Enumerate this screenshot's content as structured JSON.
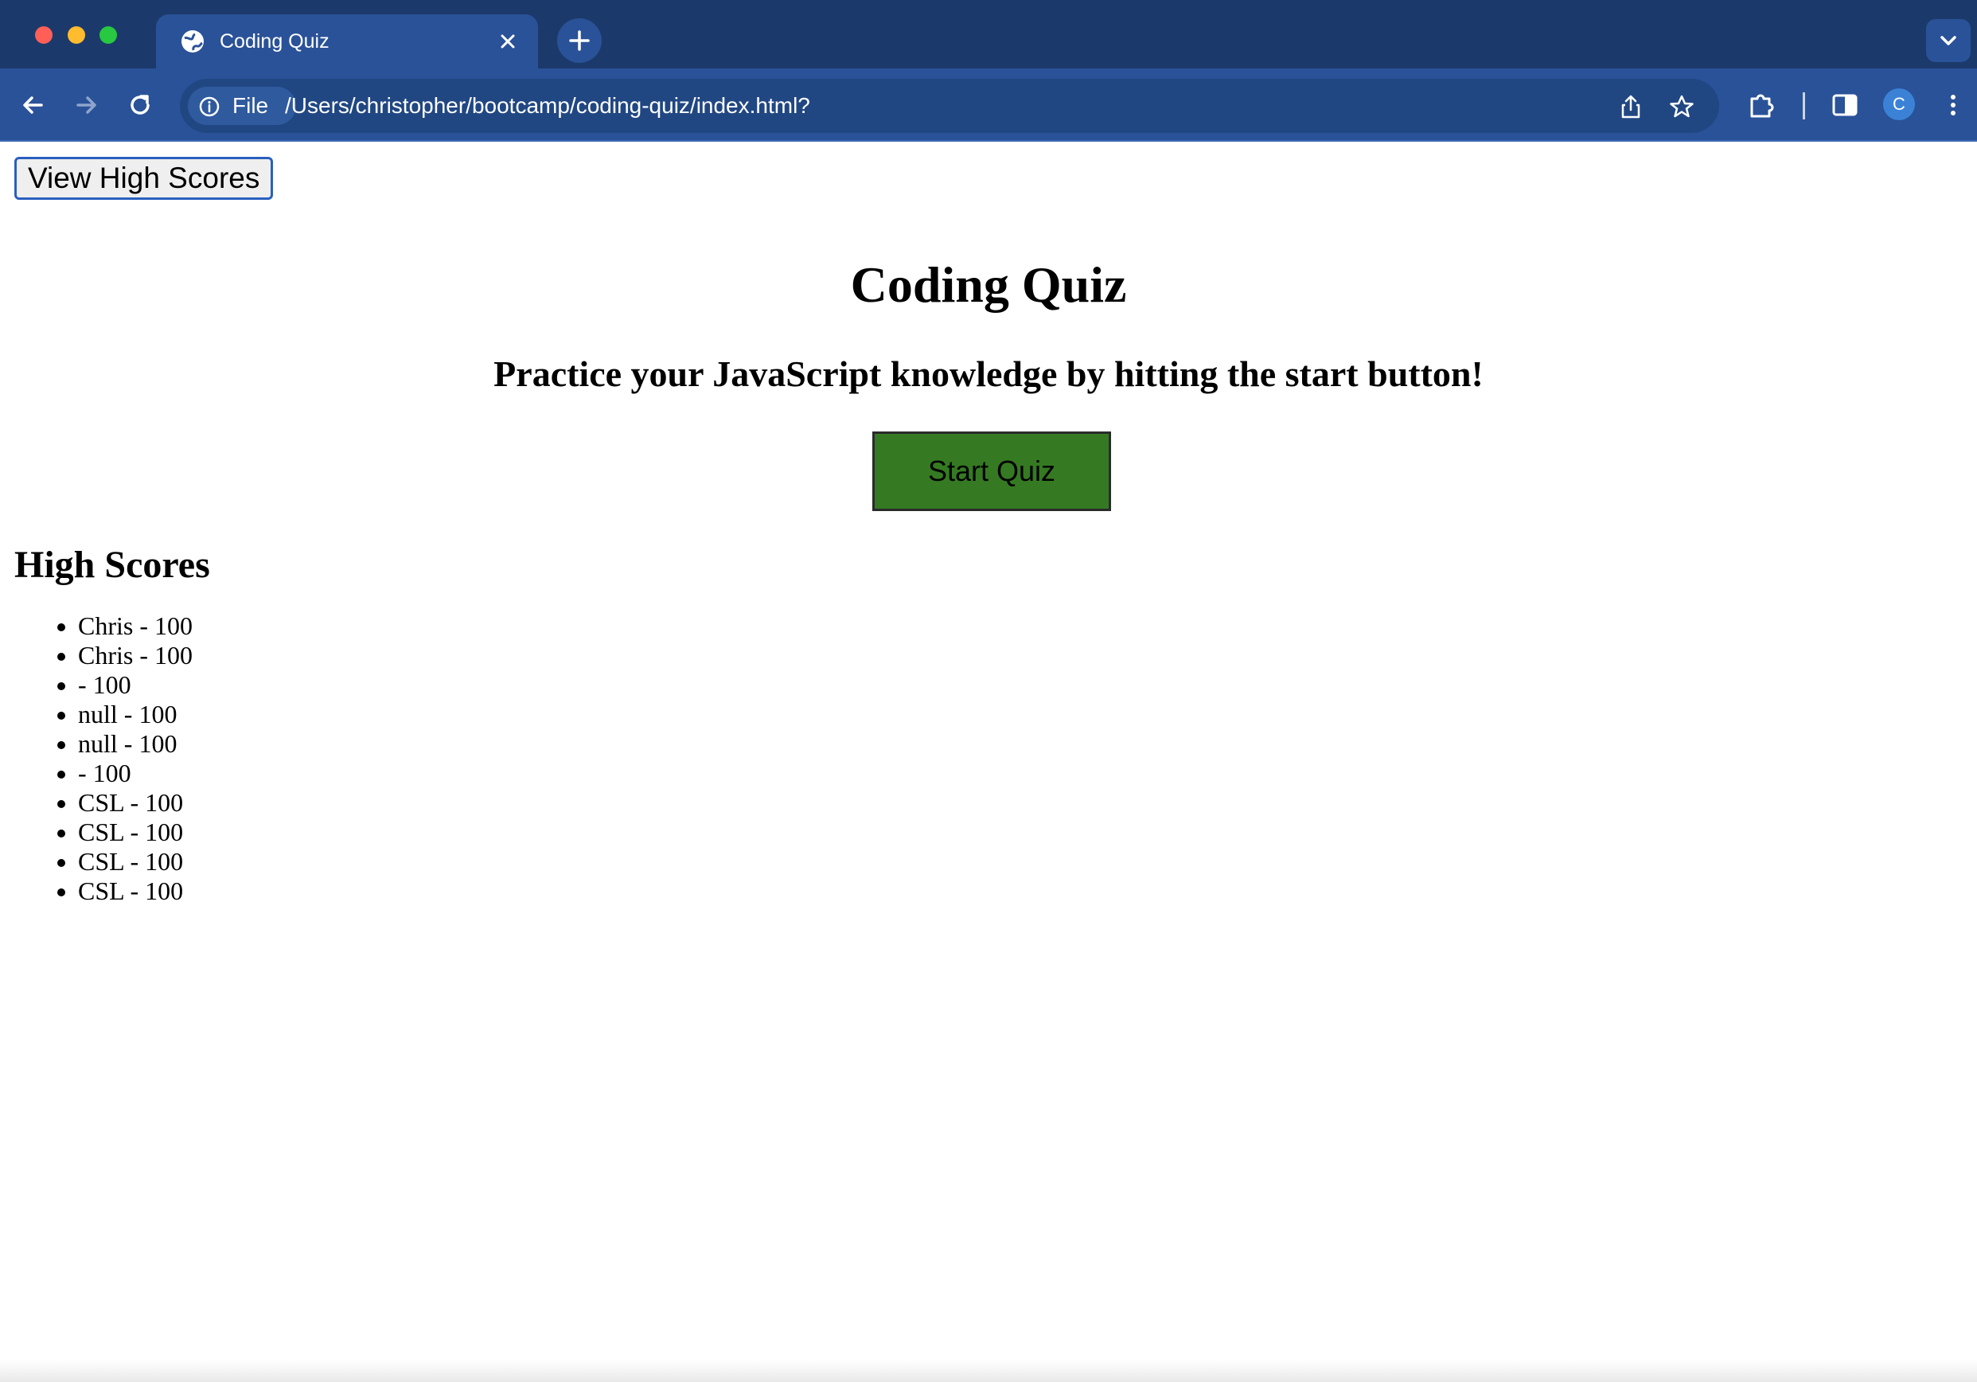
{
  "browser": {
    "tab_title": "Coding Quiz",
    "address_chip": "File",
    "url": "/Users/christopher/bootcamp/coding-quiz/index.html?",
    "profile_initial": "C"
  },
  "page": {
    "high_scores_button": "View High Scores",
    "title": "Coding Quiz",
    "subtitle": "Practice your JavaScript knowledge by hitting the start button!",
    "start_button": "Start Quiz",
    "high_scores_heading": "High Scores",
    "high_scores": [
      "Chris - 100",
      "Chris - 100",
      "- 100",
      "null - 100",
      "null - 100",
      "- 100",
      "CSL - 100",
      "CSL - 100",
      "CSL - 100",
      "CSL - 100"
    ]
  },
  "colors": {
    "tabbar": "#1b3a6b",
    "toolbar": "#2a5298",
    "start_button": "#357a22"
  }
}
